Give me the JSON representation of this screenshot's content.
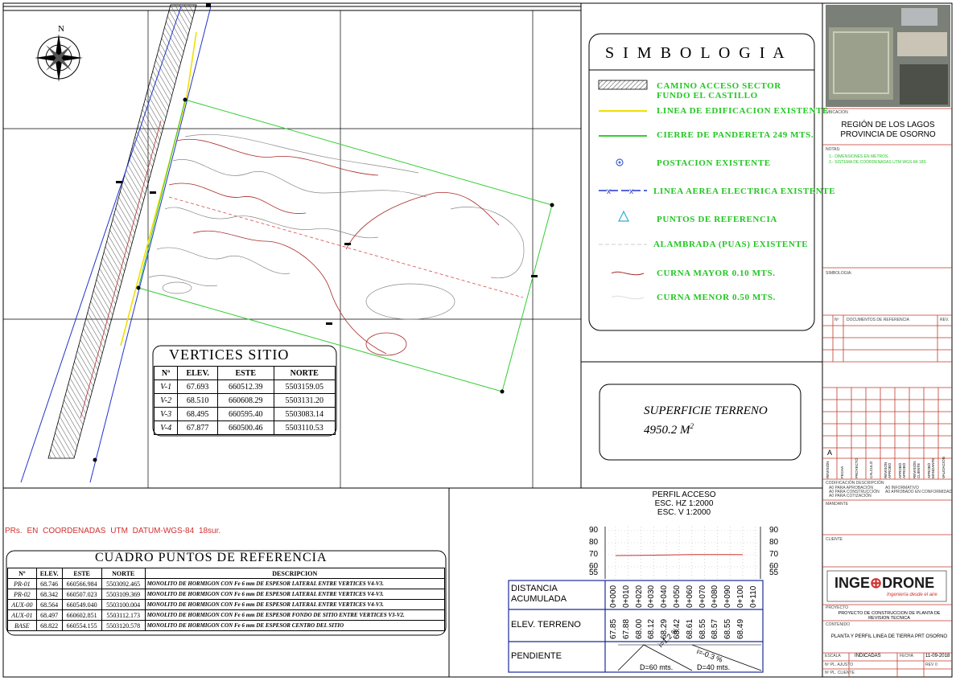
{
  "north_label": "N",
  "symbology": {
    "title": "S I M B O L O G I A",
    "items": [
      {
        "label": "CAMINO ACCESO SECTOR FUNDO EL CASTILLO"
      },
      {
        "label": "LINEA DE EDIFICACION EXISTENTE"
      },
      {
        "label": "CIERRE DE PANDERETA 249 MTS."
      },
      {
        "label": "POSTACION EXISTENTE"
      },
      {
        "label": "LINEA AEREA ELECTRICA EXISTENTE"
      },
      {
        "label": "PUNTOS DE REFERENCIA"
      },
      {
        "label": "ALAMBRADA (PUAS) EXISTENTE"
      },
      {
        "label": "CURNA MAYOR 0.10 MTS."
      },
      {
        "label": "CURNA MENOR 0.50 MTS."
      }
    ]
  },
  "vertices": {
    "title": "VERTICES SITIO",
    "headers": [
      "Nº",
      "ELEV.",
      "ESTE",
      "NORTE"
    ],
    "rows": [
      [
        "V-1",
        "67.693",
        "660512.39",
        "5503159.05"
      ],
      [
        "V-2",
        "68.510",
        "660608.29",
        "5503131.20"
      ],
      [
        "V-3",
        "68.495",
        "660595.40",
        "5503083.14"
      ],
      [
        "V-4",
        "67.877",
        "660500.46",
        "5503110.53"
      ]
    ]
  },
  "surface": {
    "line1": "SUPERFICIE TERRENO",
    "value": "4950.2",
    "unit": "M",
    "exp": "2"
  },
  "coords_note": "PRs. EN COORDENADAS UTM DATUM-WGS-84 18sur.",
  "ref_points": {
    "title": "CUADRO PUNTOS DE REFERENCIA",
    "headers": [
      "Nº",
      "ELEV.",
      "ESTE",
      "NORTE",
      "DESCRIPCION"
    ],
    "rows": [
      [
        "PR-01",
        "68.746",
        "660566.984",
        "5503092.465",
        "MONOLITO DE HORMIGON CON Fe 6 mm DE ESPESOR LATERAL ENTRE VERTICES V4-V3."
      ],
      [
        "PR-02",
        "68.342",
        "660507.023",
        "5503109.369",
        "MONOLITO DE HORMIGON CON Fe 6 mm DE ESPESOR LATERAL ENTRE VERTICES V4-V3."
      ],
      [
        "AUX-00",
        "68.564",
        "660549.040",
        "5503100.004",
        "MONOLITO DE HORMIGON CON Fe 6 mm DE ESPESOR LATERAL ENTRE VERTICES V4-V3."
      ],
      [
        "AUX-01",
        "68.497",
        "660602.851",
        "5503112.173",
        "MONOLITO DE HORMIGON CON Fe 6 mm DE ESPESOR FONDO DE SITIO ENTRE VERTICES V3-V2."
      ],
      [
        "BASE",
        "68.822",
        "660554.155",
        "5503120.578",
        "MONOLITO DE HORMIGON CON Fe 6 mm DE ESPESOR CENTRO DEL SITIO"
      ]
    ]
  },
  "profile": {
    "title": "PERFIL ACCESO",
    "scale_h": "ESC. HZ 1:2000",
    "scale_v": "ESC. V 1:2000",
    "y_ticks": [
      "90",
      "80",
      "70",
      "60",
      "55"
    ],
    "row_labels": [
      "DISTANCIA ACUMULADA",
      "ELEV. TERRENO",
      "PENDIENTE"
    ],
    "stations": [
      "0+000",
      "0+010",
      "0+020",
      "0+030",
      "0+040",
      "0+050",
      "0+060",
      "0+070",
      "0+080",
      "0+090",
      "0+100",
      "0+110"
    ],
    "elevations": [
      "67.85",
      "67.88",
      "68.00",
      "68.12",
      "68.29",
      "68.42",
      "68.61",
      "68.55",
      "68.57",
      "68.55",
      "68.49"
    ],
    "slope1": "i=1.2 %",
    "dist1": "D=60 mts.",
    "slope2": "i=-0.3 %",
    "dist2": "D=40 mts."
  },
  "chart_data": {
    "type": "line",
    "title": "PERFIL ACCESO",
    "xlabel": "DISTANCIA ACUMULADA",
    "ylabel": "",
    "x": [
      "0+000",
      "0+010",
      "0+020",
      "0+030",
      "0+040",
      "0+050",
      "0+060",
      "0+070",
      "0+080",
      "0+090",
      "0+100"
    ],
    "series": [
      {
        "values": [
          67.85,
          67.88,
          68.0,
          68.12,
          68.29,
          68.42,
          68.61,
          68.55,
          68.57,
          68.55,
          68.49
        ]
      }
    ],
    "ylim": [
      55,
      90
    ]
  },
  "title_block": {
    "ubicacion_label": "UBICACION",
    "ubicacion": "REGIÓN DE LOS LAGOS\nPROVINCIA DE OSORNO",
    "notas_label": "NOTAS:",
    "notas": [
      "1.- DIMENSIONES EN METROS.",
      "2.- SISTEMA DE COORDENADAS UTM WGS-84 18S"
    ],
    "simbologia_label": "SIMBOLOGIA:",
    "docs_headers": [
      "Nº",
      "DOCUMENTOS DE REFERENCIA",
      "REV."
    ],
    "rev_letter": "A",
    "rev_cols": [
      "REVISIÓN",
      "FECHA",
      "PROYECTÓ",
      "CALCULÓ",
      "REVISÓN APROBÓ",
      "APROBÓ APROBÓ",
      "REVISIÓN CLIENTE",
      "APROBÓ MANDANTE",
      "VALIDACIÓN"
    ],
    "codificacion": "CODIFICACIÓN  DESCRIPCIÓN",
    "cod_left": [
      "A0 PARA APROBACIÓN",
      "A0 PARA CONSTRUCCIÓN",
      "A0 PARA COTIZACIÓN"
    ],
    "cod_right": [
      "A0 INFORMATIVO",
      "A0 APROBADO EN CONFORMIDAD"
    ],
    "mandante_label": "MANDANTE",
    "cliente_label": "CLIENTE",
    "logo_text1": "INGE",
    "logo_text2": "DRONE",
    "logo_tag": "Ingeniería desde el aire",
    "proyecto_label": "PROYECTO",
    "proyecto": "PROYECTO DE CONSTRUCCION DE PLANTA DE REVISION TECNICA",
    "contenido_label": "CONTENIDO",
    "contenido": "PLANTA Y PERFIL LINEA DE TIERRA PRT OSORNO",
    "escala_label": "ESCALA",
    "escala": "INDICADAS",
    "fecha_label": "FECHA",
    "fecha": "11-09-2018",
    "plano_label": "Nº PL. AJUSTO",
    "rev_label": "REV",
    "rev_val": "0",
    "cliente_plano": "Nº PL. CLIENTE"
  }
}
